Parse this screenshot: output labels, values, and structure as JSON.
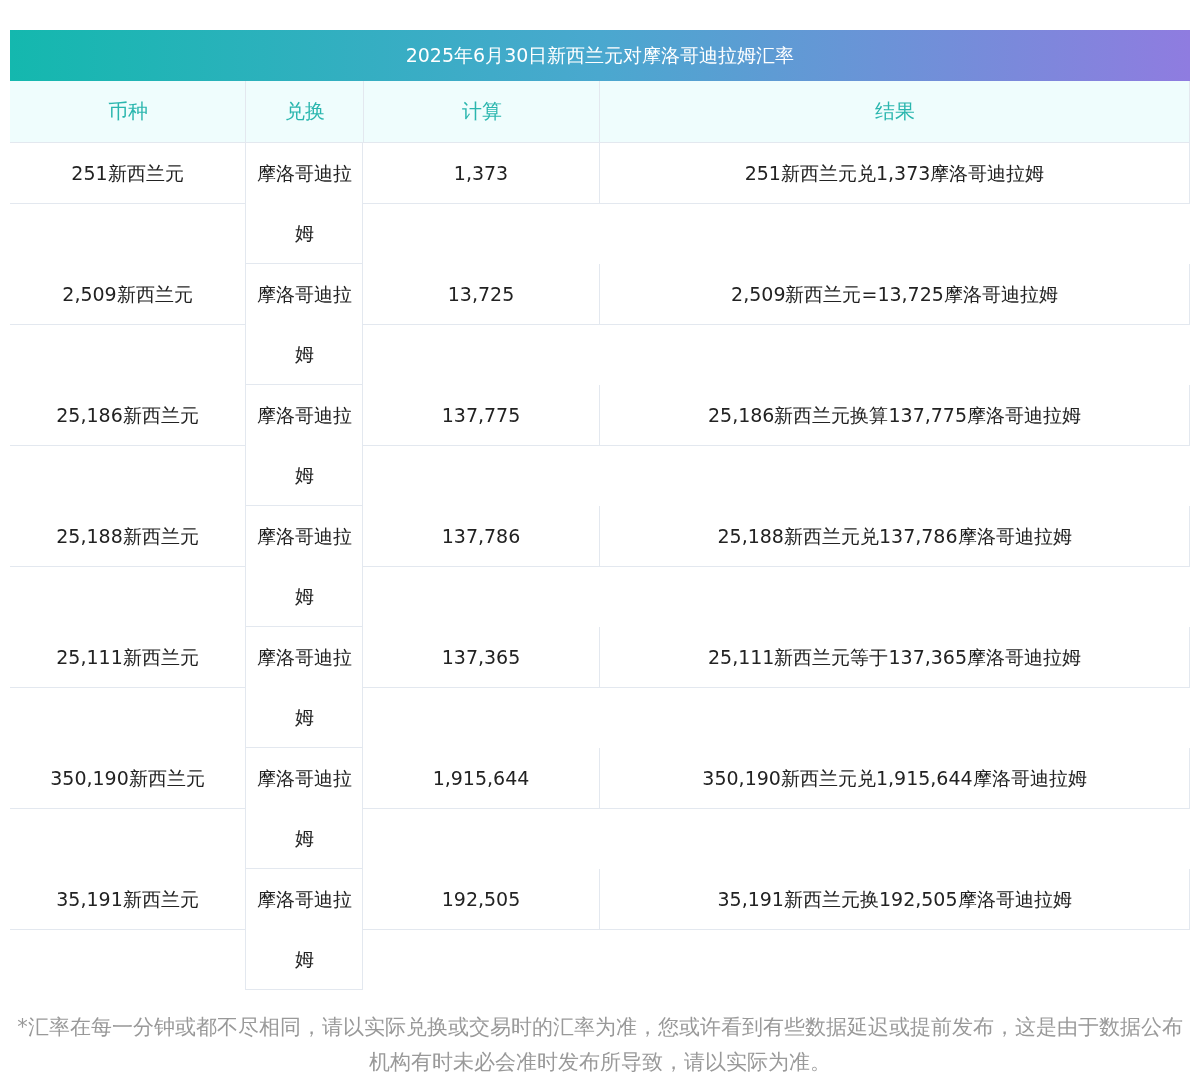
{
  "title": "2025年6月30日新西兰元对摩洛哥迪拉姆汇率",
  "columns": [
    "币种",
    "兑换",
    "计算",
    "结果"
  ],
  "rows": [
    {
      "currency": "251新西兰元",
      "exchange": "摩洛哥迪拉姆",
      "calc": "1,373",
      "result": "251新西兰元兑1,373摩洛哥迪拉姆"
    },
    {
      "currency": "2,509新西兰元",
      "exchange": "摩洛哥迪拉姆",
      "calc": "13,725",
      "result": "2,509新西兰元=13,725摩洛哥迪拉姆"
    },
    {
      "currency": "25,186新西兰元",
      "exchange": "摩洛哥迪拉姆",
      "calc": "137,775",
      "result": "25,186新西兰元换算137,775摩洛哥迪拉姆"
    },
    {
      "currency": "25,188新西兰元",
      "exchange": "摩洛哥迪拉姆",
      "calc": "137,786",
      "result": "25,188新西兰元兑137,786摩洛哥迪拉姆"
    },
    {
      "currency": "25,111新西兰元",
      "exchange": "摩洛哥迪拉姆",
      "calc": "137,365",
      "result": "25,111新西兰元等于137,365摩洛哥迪拉姆"
    },
    {
      "currency": "350,190新西兰元",
      "exchange": "摩洛哥迪拉姆",
      "calc": "1,915,644",
      "result": "350,190新西兰元兑1,915,644摩洛哥迪拉姆"
    },
    {
      "currency": "35,191新西兰元",
      "exchange": "摩洛哥迪拉姆",
      "calc": "192,505",
      "result": "35,191新西兰元换192,505摩洛哥迪拉姆"
    }
  ],
  "note": "*汇率在每一分钟或都不尽相同，请以实际兑换或交易时的汇率为准，您或许看到有些数据延迟或提前发布，这是由于数据公布机构有时未必会准时发布所导致，请以实际为准。"
}
